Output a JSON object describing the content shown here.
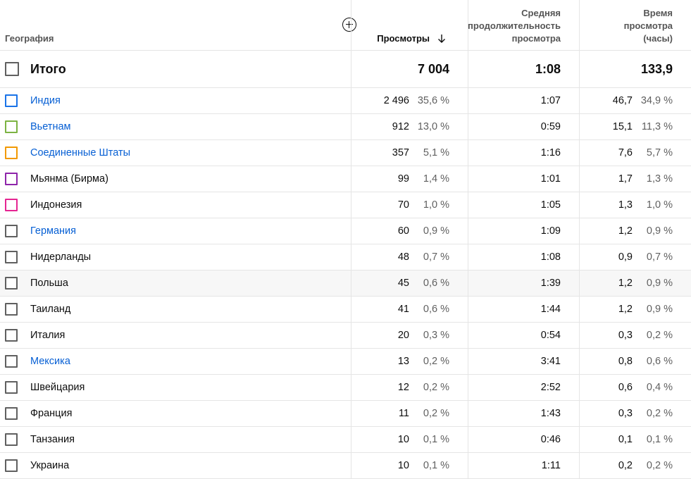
{
  "header": {
    "geography": "География",
    "views": "Просмотры",
    "avg_duration": "Средняя\nпродолжительность\nпросмотра",
    "watch_time": "Время\nпросмотра\n(часы)"
  },
  "total": {
    "label": "Итого",
    "views": "7 004",
    "avg_duration": "1:08",
    "watch_time": "133,9"
  },
  "colors": {
    "link": "#065fd4",
    "checkbox_default": "#606060"
  },
  "rows": [
    {
      "name": "Индия",
      "link": true,
      "checkbox_color": "#1a73e8",
      "views": "2 496",
      "views_pct": "35,6 %",
      "avg": "1:07",
      "time": "46,7",
      "time_pct": "34,9 %"
    },
    {
      "name": "Вьетнам",
      "link": true,
      "checkbox_color": "#7cb342",
      "views": "912",
      "views_pct": "13,0 %",
      "avg": "0:59",
      "time": "15,1",
      "time_pct": "11,3 %"
    },
    {
      "name": "Соединенные Штаты",
      "link": true,
      "checkbox_color": "#f29900",
      "views": "357",
      "views_pct": "5,1 %",
      "avg": "1:16",
      "time": "7,6",
      "time_pct": "5,7 %"
    },
    {
      "name": "Мьянма (Бирма)",
      "link": false,
      "checkbox_color": "#8e24aa",
      "views": "99",
      "views_pct": "1,4 %",
      "avg": "1:01",
      "time": "1,7",
      "time_pct": "1,3 %"
    },
    {
      "name": "Индонезия",
      "link": false,
      "checkbox_color": "#e52592",
      "views": "70",
      "views_pct": "1,0 %",
      "avg": "1:05",
      "time": "1,3",
      "time_pct": "1,0 %"
    },
    {
      "name": "Германия",
      "link": true,
      "checkbox_color": "#606060",
      "views": "60",
      "views_pct": "0,9 %",
      "avg": "1:09",
      "time": "1,2",
      "time_pct": "0,9 %"
    },
    {
      "name": "Нидерланды",
      "link": false,
      "checkbox_color": "#606060",
      "views": "48",
      "views_pct": "0,7 %",
      "avg": "1:08",
      "time": "0,9",
      "time_pct": "0,7 %"
    },
    {
      "name": "Польша",
      "link": false,
      "checkbox_color": "#606060",
      "highlight": true,
      "views": "45",
      "views_pct": "0,6 %",
      "avg": "1:39",
      "time": "1,2",
      "time_pct": "0,9 %"
    },
    {
      "name": "Таиланд",
      "link": false,
      "checkbox_color": "#606060",
      "views": "41",
      "views_pct": "0,6 %",
      "avg": "1:44",
      "time": "1,2",
      "time_pct": "0,9 %"
    },
    {
      "name": "Италия",
      "link": false,
      "checkbox_color": "#606060",
      "views": "20",
      "views_pct": "0,3 %",
      "avg": "0:54",
      "time": "0,3",
      "time_pct": "0,2 %"
    },
    {
      "name": "Мексика",
      "link": true,
      "checkbox_color": "#606060",
      "views": "13",
      "views_pct": "0,2 %",
      "avg": "3:41",
      "time": "0,8",
      "time_pct": "0,6 %"
    },
    {
      "name": "Швейцария",
      "link": false,
      "checkbox_color": "#606060",
      "views": "12",
      "views_pct": "0,2 %",
      "avg": "2:52",
      "time": "0,6",
      "time_pct": "0,4 %"
    },
    {
      "name": "Франция",
      "link": false,
      "checkbox_color": "#606060",
      "views": "11",
      "views_pct": "0,2 %",
      "avg": "1:43",
      "time": "0,3",
      "time_pct": "0,2 %"
    },
    {
      "name": "Танзания",
      "link": false,
      "checkbox_color": "#606060",
      "views": "10",
      "views_pct": "0,1 %",
      "avg": "0:46",
      "time": "0,1",
      "time_pct": "0,1 %"
    },
    {
      "name": "Украина",
      "link": false,
      "checkbox_color": "#606060",
      "views": "10",
      "views_pct": "0,1 %",
      "avg": "1:11",
      "time": "0,2",
      "time_pct": "0,2 %"
    }
  ]
}
